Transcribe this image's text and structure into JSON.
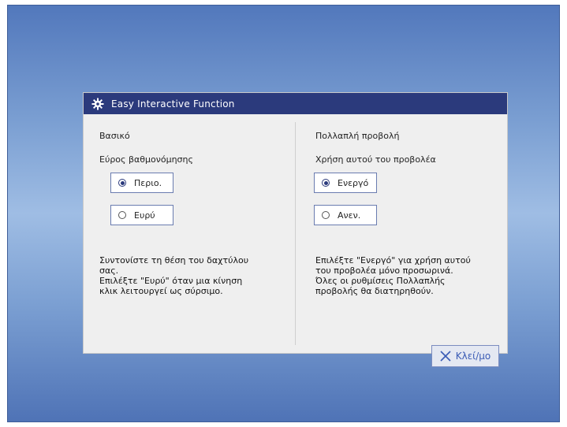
{
  "dialog": {
    "title": "Easy Interactive Function",
    "title_icon": "gear-icon"
  },
  "left": {
    "heading": "Βασικό",
    "subheading": "Εύρος βαθμονόμησης",
    "options": [
      {
        "label": "Περιο.",
        "selected": true
      },
      {
        "label": "Ευρύ",
        "selected": false
      }
    ],
    "description": "Συντονίστε τη θέση του δαχτύλου\nσας.\nΕπιλέξτε \"Ευρύ\" όταν μια κίνηση\nκλικ λειτουργεί ως σύρσιμο."
  },
  "right": {
    "heading": "Πολλαπλή προβολή",
    "subheading": "Χρήση αυτού του προβολέα",
    "options": [
      {
        "label": "Ενεργό",
        "selected": true
      },
      {
        "label": "Ανεν.",
        "selected": false
      }
    ],
    "description": "Επιλέξτε \"Ενεργό\" για χρήση αυτού\nτου προβολέα μόνο προσωρινά.\nΌλες οι ρυθμίσεις Πολλαπλής\nπροβολής θα διατηρηθούν."
  },
  "close_button": {
    "label": "Κλεί/μο",
    "icon": "close-icon"
  },
  "colors": {
    "titlebar": "#2b3a7c",
    "accent": "#3a5bb5"
  }
}
